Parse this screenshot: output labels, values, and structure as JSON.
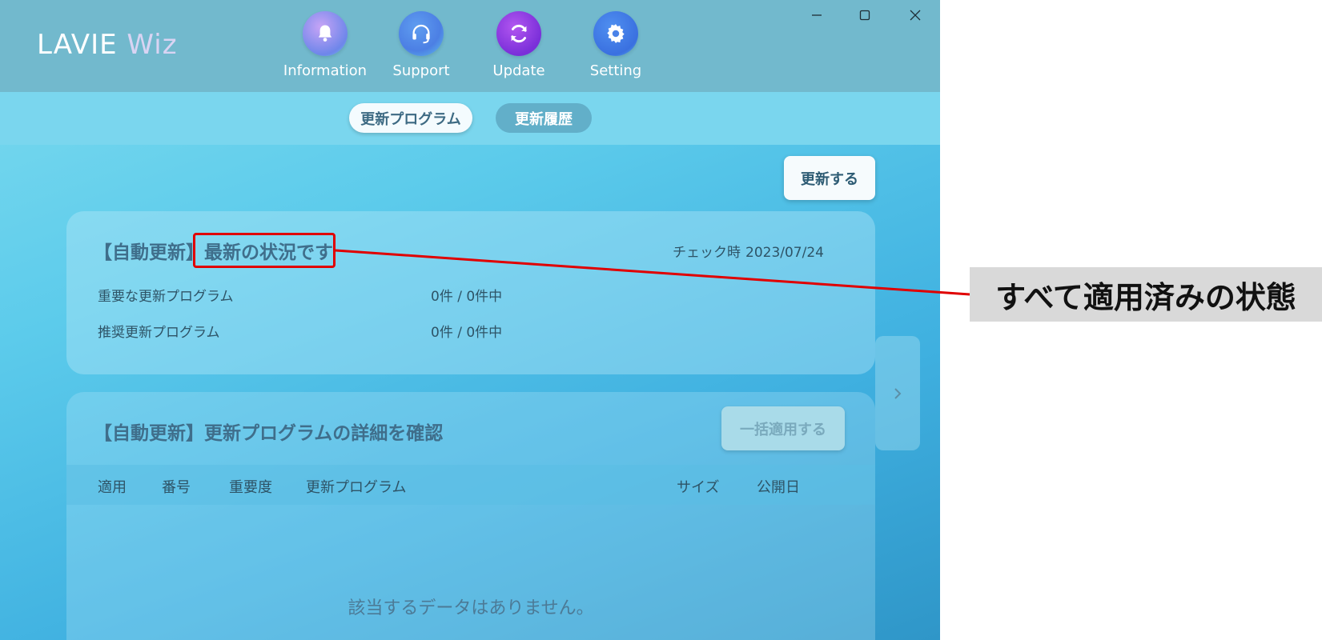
{
  "app": {
    "logo_main": "LAVIE",
    "logo_accent": "Wiz"
  },
  "nav": [
    {
      "label": "Information",
      "icon": "bell-icon"
    },
    {
      "label": "Support",
      "icon": "headset-icon"
    },
    {
      "label": "Update",
      "icon": "refresh-icon"
    },
    {
      "label": "Setting",
      "icon": "gear-icon"
    }
  ],
  "tabs": {
    "active": "更新プログラム",
    "inactive": "更新履歴"
  },
  "toolbar": {
    "refresh_label": "更新する"
  },
  "status_card": {
    "title_prefix": "【自動更新】",
    "title_status": "最新の状況です",
    "check_label": "チェック時",
    "check_date": "2023/07/24",
    "rows": [
      {
        "label": "重要な更新プログラム",
        "value": "0件 / 0件中"
      },
      {
        "label": "推奨更新プログラム",
        "value": "0件 / 0件中"
      }
    ]
  },
  "detail_card": {
    "title": "【自動更新】更新プログラムの詳細を確認",
    "apply_all_label": "一括適用する",
    "columns": [
      "適用",
      "番号",
      "重要度",
      "更新プログラム",
      "サイズ",
      "公開日"
    ],
    "empty_message": "該当するデータはありません。"
  },
  "annotation": {
    "callout_text": "すべて適用済みの状態",
    "color": "#e00000"
  }
}
